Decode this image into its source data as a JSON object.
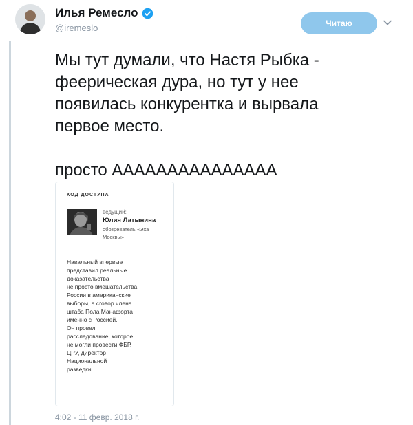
{
  "author": {
    "name": "Илья Ремесло",
    "handle": "@iremeslo",
    "verified": true,
    "accent_color": "#1da1f2"
  },
  "actions": {
    "follow_label": "Читаю",
    "follow_color": "#8fc7ec",
    "more_icon": "chevron-down-icon"
  },
  "tweet": {
    "line1": "Мы тут думали, что Настя Рыбка -",
    "line2": "феерическая дура, но тут у нее",
    "line3": "появилась конкурентка и вырвала",
    "line4": "первое место.",
    "line5": "просто ААААААААААААААА",
    "timestamp": "4:02 - 11 февр. 2018 г."
  },
  "media": {
    "header": "КОД ДОСТУПА",
    "host_role": "ведущий:",
    "host_name": "Юлия Латынина",
    "host_desc": "обозреватель «Эха Москвы»",
    "body": [
      "Навальный впервые",
      "представил реальные",
      "доказательства",
      "не просто вмешательства",
      "России в американские",
      "выборы, а сговор члена",
      "штаба Пола Манафорта",
      "именно с Россией.",
      "Он провел",
      "расследование, которое",
      "не могли провести ФБР,",
      "ЦРУ, директор",
      "Национальной",
      "разведки..."
    ]
  }
}
